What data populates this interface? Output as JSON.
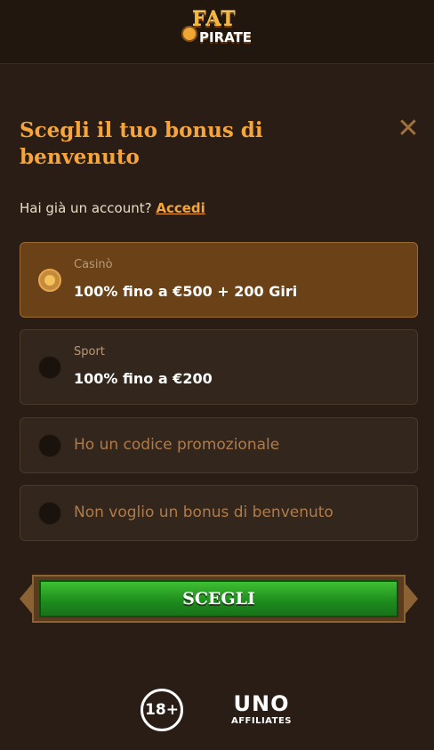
{
  "header": {
    "logo_line1": "FAT",
    "logo_line2": "PIRATE"
  },
  "modal": {
    "title": "Scegli il tuo bonus di benvenuto",
    "account_prompt": "Hai già un account?",
    "login_link": "Accedi",
    "options": [
      {
        "label": "Casinò",
        "value": "100% fino a €500 + 200 Giri",
        "selected": true
      },
      {
        "label": "Sport",
        "value": "100% fino a €200",
        "selected": false
      },
      {
        "label": "Ho un codice promozionale",
        "selected": false
      },
      {
        "label": "Non voglio un bonus di benvenuto",
        "selected": false
      }
    ],
    "submit_label": "SCEGLI"
  },
  "footer": {
    "age_badge": "18+",
    "affiliate_line1": "UNO",
    "affiliate_line2": "AFFILIATES"
  },
  "colors": {
    "accent": "#f5a53a",
    "selected_bg": "#6b4118",
    "button_green": "#1c8a1c"
  }
}
